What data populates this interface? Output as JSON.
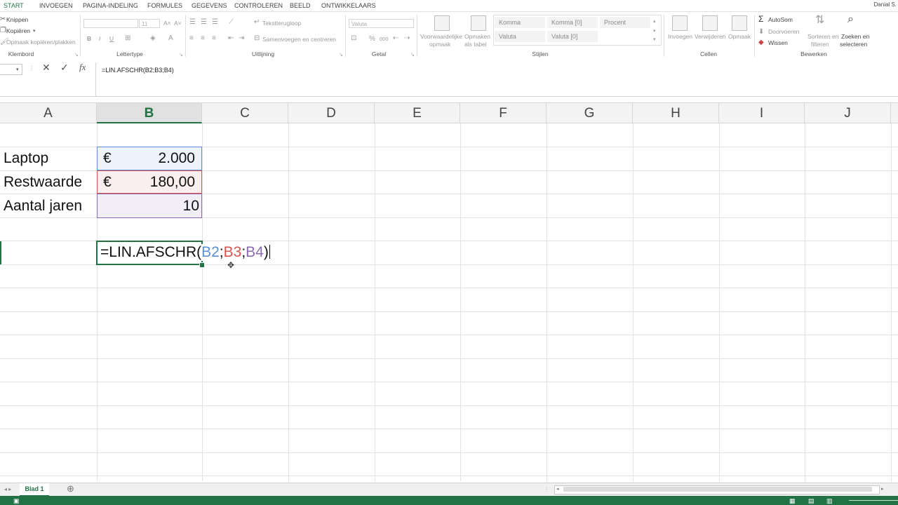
{
  "menu": {
    "tabs": [
      "START",
      "INVOEGEN",
      "PAGINA-INDELING",
      "FORMULES",
      "GEGEVENS",
      "CONTROLEREN",
      "BEELD",
      "ONTWIKKELAARS"
    ],
    "user": "Danial S."
  },
  "ribbon": {
    "clipboard": {
      "cut": "Knippen",
      "copy": "Kopiëren",
      "painter": "Opmaak kopiëren/plakken",
      "group": "Klembord"
    },
    "font": {
      "size": "11",
      "bold": "B",
      "italic": "I",
      "underline": "U",
      "group": "Lettertype",
      "grow": "A˄",
      "shrink": "A˅"
    },
    "alignment": {
      "wrap": "Tekstterugloop",
      "merge": "Samenvoegen en centreren",
      "group": "Uitlijning"
    },
    "number": {
      "format": "Valuta",
      "percent": "%",
      "thousands": "000",
      "group": "Getal"
    },
    "styles": {
      "cond_line1": "Voorwaardelijke",
      "cond_line2": "opmaak",
      "table_line1": "Opmaken",
      "table_line2": "als tabel",
      "cells": [
        "Komma",
        "Komma [0]",
        "Procent",
        "Valuta",
        "Valuta [0]"
      ],
      "group": "Stijlen"
    },
    "cells": {
      "insert": "Invoegen",
      "delete": "Verwijderen",
      "format": "Opmaak",
      "group": "Cellen"
    },
    "editing": {
      "autosum": "AutoSom",
      "fill": "Doorvoeren",
      "clear": "Wissen",
      "sort_line1": "Sorteren en",
      "sort_line2": "filteren",
      "find_line1": "Zoeken en",
      "find_line2": "selecteren",
      "group": "Bewerken"
    }
  },
  "formula_bar": {
    "fx": "fx",
    "content": "=LIN.AFSCHR(B2;B3;B4)"
  },
  "columns": [
    "A",
    "B",
    "C",
    "D",
    "E",
    "F",
    "G",
    "H",
    "I",
    "J"
  ],
  "selected_column": "B",
  "cells": {
    "a2": "Laptop",
    "a3": "Restwaarde",
    "a4": "Aantal jaren",
    "b2_sym": "€",
    "b2_val": "2.000",
    "b3_sym": "€",
    "b3_val": "180,00",
    "b4_val": "10"
  },
  "editing_cell": {
    "prefix": "=LIN.AFSCHR(",
    "ref1": "B2",
    "sep1": ";",
    "ref2": "B3",
    "sep2": ";",
    "ref3": "B4",
    "suffix": ")"
  },
  "ref_colors": {
    "ref1": "#5b8fd6",
    "ref2": "#d9534f",
    "ref3": "#8e6bb8"
  },
  "sheet": {
    "tab": "Blad 1"
  }
}
